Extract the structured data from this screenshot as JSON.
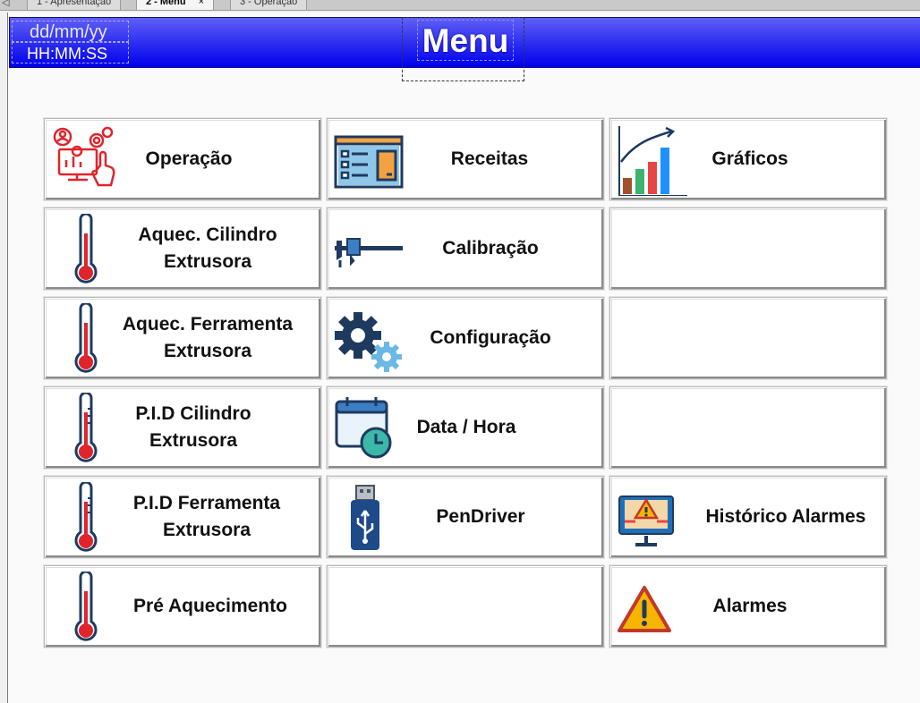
{
  "tabs": [
    {
      "label": "1 - Apresentação"
    },
    {
      "label": "2 - Menu",
      "close": "×"
    },
    {
      "label": "3 - Operação"
    }
  ],
  "header": {
    "date": "dd/mm/yy",
    "time": "HH:MM:SS",
    "title": "Menu"
  },
  "buttons": {
    "operacao": {
      "label": "Operação"
    },
    "receitas": {
      "label": "Receitas"
    },
    "graficos": {
      "label": "Gráficos"
    },
    "aquec_cilindro": {
      "line1": "Aquec. Cilindro",
      "line2": "Extrusora"
    },
    "calibracao": {
      "label": "Calibração"
    },
    "aquec_ferramenta": {
      "line1": "Aquec. Ferramenta",
      "line2": "Extrusora"
    },
    "configuracao": {
      "label": "Configuração"
    },
    "pid_cilindro": {
      "line1": "P.I.D Cilindro",
      "line2": "Extrusora"
    },
    "data_hora": {
      "label": "Data / Hora"
    },
    "pid_ferramenta": {
      "line1": "P.I.D Ferramenta",
      "line2": "Extrusora"
    },
    "pendriver": {
      "label": "PenDriver"
    },
    "historico_alarmes": {
      "label": "Histórico  Alarmes"
    },
    "pre_aquecimento": {
      "label": "Pré Aquecimento"
    },
    "alarmes": {
      "label": "Alarmes"
    }
  },
  "colors": {
    "header": "#0000ee",
    "thermometer": "#e0242c",
    "alarm": "#f7b500"
  }
}
